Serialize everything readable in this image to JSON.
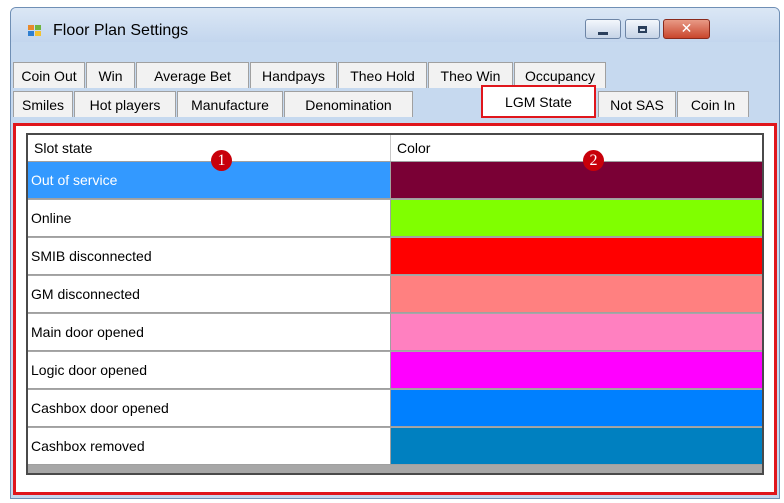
{
  "window": {
    "title": "Floor Plan Settings"
  },
  "tabs_row1": [
    "Coin Out",
    "Win",
    "Average Bet",
    "Handpays",
    "Theo Hold",
    "Theo Win",
    "Occupancy"
  ],
  "tabs_row2": [
    "Smiles",
    "Hot players",
    "Manufacture",
    "Denomination",
    "LGM State",
    "Not SAS",
    "Coin In"
  ],
  "active_tab": "LGM State",
  "grid": {
    "headers": {
      "state": "Slot state",
      "color": "Color"
    },
    "rows": [
      {
        "state": "Out of service",
        "color": "#7a0035",
        "selected": true
      },
      {
        "state": "Online",
        "color": "#80ff00"
      },
      {
        "state": "SMIB disconnected",
        "color": "#ff0000"
      },
      {
        "state": "GM disconnected",
        "color": "#ff8080"
      },
      {
        "state": "Main door opened",
        "color": "#ff80c0"
      },
      {
        "state": "Logic door opened",
        "color": "#ff00ff"
      },
      {
        "state": "Cashbox door opened",
        "color": "#0080ff"
      },
      {
        "state": "Cashbox removed",
        "color": "#0080c0"
      }
    ]
  },
  "annotations": {
    "badge1": "1",
    "badge2": "2"
  },
  "colors": {
    "highlight": "#e0161c",
    "selection": "#3399ff"
  }
}
